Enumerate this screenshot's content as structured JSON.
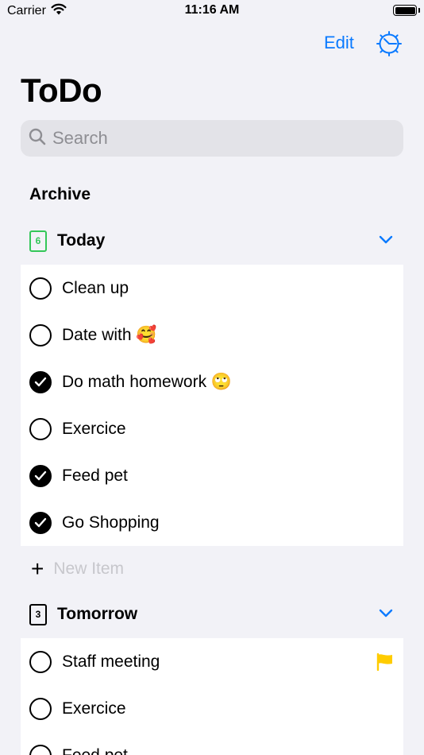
{
  "status_bar": {
    "carrier": "Carrier",
    "time": "11:16 AM"
  },
  "nav": {
    "edit_label": "Edit",
    "settings_icon": "gear-timer-icon",
    "accent_color": "#0a7aff"
  },
  "title": "ToDo",
  "search": {
    "placeholder": "Search",
    "value": ""
  },
  "archive_label": "Archive",
  "sections": {
    "today": {
      "title": "Today",
      "calendar_day": "6",
      "icon_color": "#34c759",
      "items": [
        {
          "text": "Clean up",
          "done": false
        },
        {
          "text": "Date with 🥰",
          "done": false
        },
        {
          "text": "Do math homework 🙄",
          "done": true
        },
        {
          "text": "Exercice",
          "done": false
        },
        {
          "text": "Feed pet",
          "done": true
        },
        {
          "text": "Go Shopping",
          "done": true
        }
      ]
    },
    "tomorrow": {
      "title": "Tomorrow",
      "calendar_day": "3",
      "icon_color": "#000000",
      "items": [
        {
          "text": "Staff meeting",
          "done": false,
          "flagged": true,
          "flag_color": "#ffcc00"
        },
        {
          "text": "Exercice",
          "done": false
        },
        {
          "text": "Feed pet",
          "done": false
        }
      ]
    }
  },
  "new_item_label": "New Item"
}
